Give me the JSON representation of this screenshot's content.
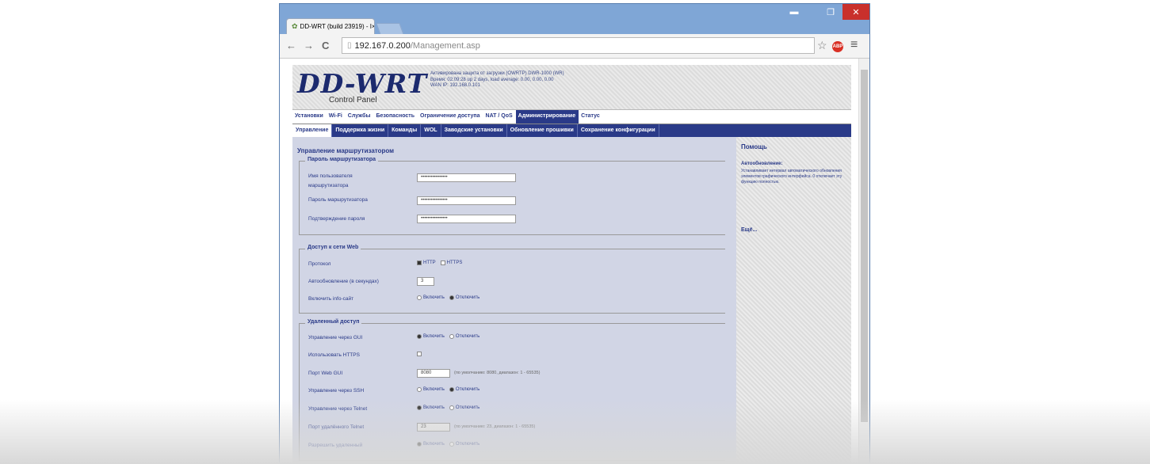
{
  "window": {
    "min_label": "▬",
    "max_label": "❐",
    "close_label": "✕"
  },
  "tab": {
    "title": "DD-WRT (build 23919) - I",
    "close": "×"
  },
  "nav": {
    "back": "←",
    "forward": "→",
    "reload": "C"
  },
  "address": {
    "host": "192.167.0.200",
    "path": "/Management.asp"
  },
  "ext_badge": "ABP",
  "header": {
    "logo": "DD-WRT",
    "sublogo": "Control Panel",
    "info_1": "Активирована защита от загрузки (OWRTP) DWR-1000 (WR)",
    "info_2": "Время: 02:09:28 up 2 days, load average: 0.00, 0.00, 0.00",
    "info_3": "WAN IP: 192.168.0.101"
  },
  "menu1": [
    "Установки",
    "Wi-Fi",
    "Службы",
    "Безопасность",
    "Ограничение доступа",
    "NAT / QoS",
    "Администрирование",
    "Статус"
  ],
  "menu1_active": 6,
  "menu2": [
    "Управление",
    "Поддержка жизни",
    "Команды",
    "WOL",
    "Заводские установки",
    "Обновление прошивки",
    "Сохранение конфигурации"
  ],
  "menu2_active": 0,
  "content": {
    "title": "Управление маршрутизатором",
    "admin": {
      "legend": "Пароль маршрутизатора",
      "user_label_1": "Имя пользователя",
      "user_label_2": "маршрутизатора",
      "user_value": "••••••••••••••••",
      "pass_label": "Пароль маршрутизатора",
      "pass_value": "••••••••••••••••",
      "confirm_label": "Подтверждение пароля",
      "confirm_value": "••••••••••••••••"
    },
    "web": {
      "legend": "Доступ к сети Web",
      "proto_label": "Протокол",
      "opt_http": "HTTP",
      "opt_https": "HTTPS",
      "refresh_label": "Автообновление (в секундах)",
      "refresh_value": "3",
      "info_label": "Включить info-сайт",
      "opt_enable": "Включить",
      "opt_disable": "Отключить"
    },
    "remote": {
      "legend": "Удаленный доступ",
      "gui_label": "Управление через GUI",
      "https_label": "Использовать HTTPS",
      "port_label": "Порт Web GUI",
      "port_value": "8080",
      "port_note": "(по умолчанию: 8080, диапазон: 1 - 65535)",
      "ssh_label": "Управление через SSH",
      "telnet_label": "Управление через Telnet",
      "telnet_port_label": "Порт удалённого Telnet",
      "telnet_port_value": "23",
      "telnet_note": "(по умолчанию: 23, диапазон: 1 - 65535)",
      "allow_label": "Разрешить удаленный",
      "opt_enable": "Включить",
      "opt_disable": "Отключить"
    }
  },
  "help": {
    "title": "Помощь",
    "subtitle": "Автообновление:",
    "text": "Устанавливает интервал автоматического обновления элементов графического интерфейса. 0 отключает эту функцию полностью.",
    "more": "Ещё..."
  }
}
